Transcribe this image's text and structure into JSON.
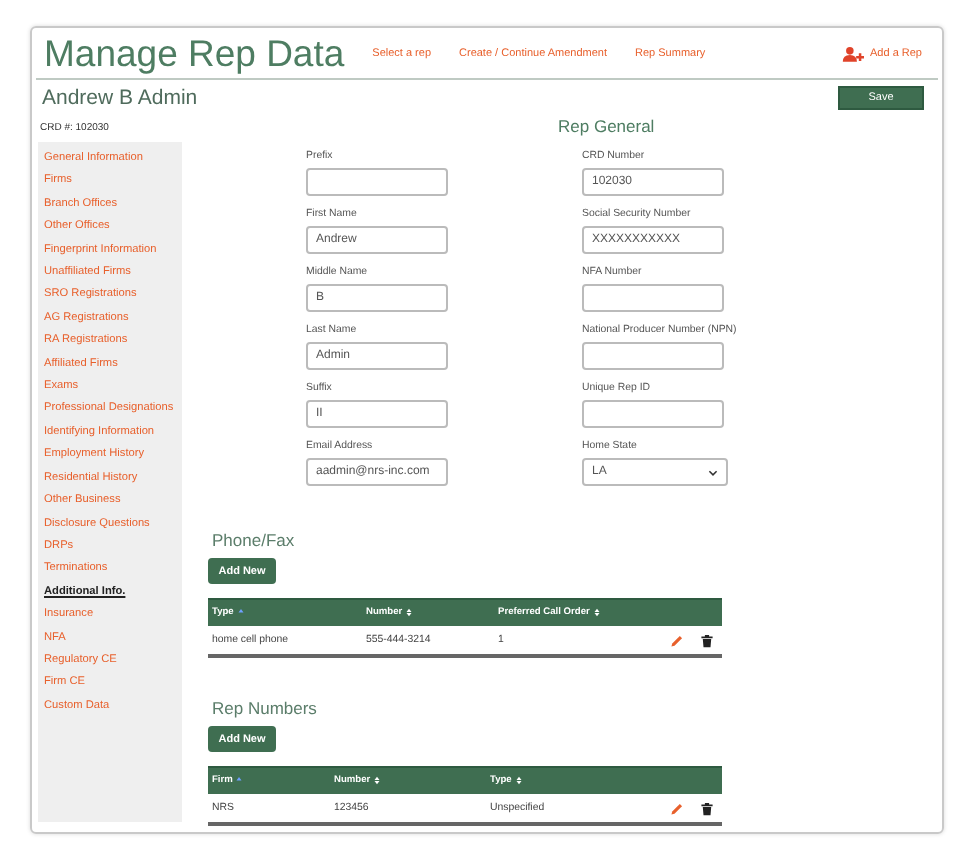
{
  "header": {
    "title": "Manage Rep Data",
    "links": [
      "Select a rep",
      "Create / Continue Amendment",
      "Rep Summary"
    ],
    "add_rep": "Add a Rep"
  },
  "rep_name": "Andrew B Admin",
  "save_button": "Save",
  "crd": "CRD #: 102030",
  "sidebar": {
    "items": [
      {
        "label": "General Information",
        "selected": false
      },
      {
        "label": "Firms",
        "selected": false
      },
      {
        "label": "Branch Offices",
        "selected": false
      },
      {
        "label": "Other Offices",
        "selected": false
      },
      {
        "label": "Fingerprint Information",
        "selected": false
      },
      {
        "label": "Unaffiliated Firms",
        "selected": false
      },
      {
        "label": "SRO Registrations",
        "selected": false
      },
      {
        "label": "AG Registrations",
        "selected": false
      },
      {
        "label": "RA Registrations",
        "selected": false
      },
      {
        "label": "Affiliated Firms",
        "selected": false
      },
      {
        "label": "Exams",
        "selected": false
      },
      {
        "label": "Professional Designations",
        "selected": false
      },
      {
        "label": "Identifying Information",
        "selected": false
      },
      {
        "label": "Employment History",
        "selected": false
      },
      {
        "label": "Residential History",
        "selected": false
      },
      {
        "label": "Other Business",
        "selected": false
      },
      {
        "label": "Disclosure Questions",
        "selected": false
      },
      {
        "label": "DRPs",
        "selected": false
      },
      {
        "label": "Terminations",
        "selected": false
      },
      {
        "label": "Additional Info.",
        "selected": true
      },
      {
        "label": "Insurance",
        "selected": false
      },
      {
        "label": "NFA",
        "selected": false
      },
      {
        "label": "Regulatory CE",
        "selected": false
      },
      {
        "label": "Firm CE",
        "selected": false
      },
      {
        "label": "Custom Data",
        "selected": false
      }
    ]
  },
  "rep_general": {
    "title": "Rep General",
    "fields": [
      {
        "label": "Prefix",
        "kind": "text"
      },
      {
        "label": "First Name",
        "value": "Andrew",
        "kind": "text"
      },
      {
        "label": "Middle Name",
        "value": "B",
        "kind": "text"
      },
      {
        "label": "Last Name",
        "value": "Admin",
        "kind": "text"
      },
      {
        "label": "Suffix",
        "value": "II",
        "kind": "text"
      },
      {
        "label": "Email Address",
        "value": "aadmin@nrs-inc.com",
        "kind": "text"
      },
      {
        "label": "CRD Number",
        "value": "102030",
        "kind": "text"
      },
      {
        "label": "Social Security Number",
        "value": "XXXXXXXXXXX",
        "kind": "text"
      },
      {
        "label": "NFA Number",
        "kind": "text"
      },
      {
        "label": "National Producer Number (NPN)",
        "kind": "text"
      },
      {
        "label": "Unique Rep ID",
        "kind": "text"
      },
      {
        "label": "Home State",
        "value": "LA",
        "kind": "select"
      }
    ]
  },
  "tables": [
    {
      "title": "Phone/Fax",
      "add_button": "Add New",
      "columns": [
        {
          "label": "Type",
          "sorted": true
        },
        {
          "label": "Number",
          "sorted": false
        },
        {
          "label": "Preferred Call Order",
          "sorted": false
        }
      ],
      "rows": [
        [
          "home cell phone",
          "555-444-3214",
          "1"
        ]
      ]
    },
    {
      "title": "Rep Numbers",
      "add_button": "Add New",
      "columns": [
        {
          "label": "Firm",
          "sorted": true
        },
        {
          "label": "Number",
          "sorted": false
        },
        {
          "label": "Type",
          "sorted": false
        }
      ],
      "rows": [
        [
          "NRS",
          "123456",
          "Unspecified"
        ]
      ]
    }
  ]
}
